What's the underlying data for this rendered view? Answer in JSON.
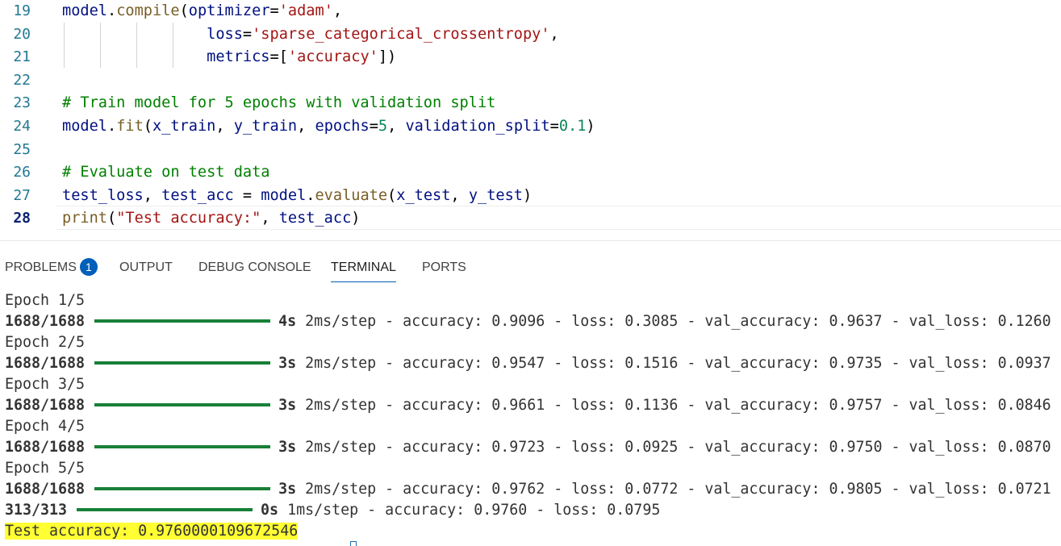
{
  "editor": {
    "lines": [
      {
        "no": "19",
        "tokens": [
          [
            "var",
            "model"
          ],
          [
            "def",
            "."
          ],
          [
            "fn",
            "compile"
          ],
          [
            "def",
            "("
          ],
          [
            "var",
            "optimizer"
          ],
          [
            "def",
            "="
          ],
          [
            "str",
            "'adam'"
          ],
          [
            "def",
            ","
          ]
        ]
      },
      {
        "no": "20",
        "tokens": [
          [
            "def",
            "                "
          ],
          [
            "var",
            "loss"
          ],
          [
            "def",
            "="
          ],
          [
            "str",
            "'sparse_categorical_crossentropy'"
          ],
          [
            "def",
            ","
          ]
        ]
      },
      {
        "no": "21",
        "tokens": [
          [
            "def",
            "                "
          ],
          [
            "var",
            "metrics"
          ],
          [
            "def",
            "=["
          ],
          [
            "str",
            "'accuracy'"
          ],
          [
            "def",
            "])"
          ]
        ]
      },
      {
        "no": "22",
        "tokens": []
      },
      {
        "no": "23",
        "tokens": [
          [
            "com",
            "# Train model for 5 epochs with validation split"
          ]
        ]
      },
      {
        "no": "24",
        "tokens": [
          [
            "var",
            "model"
          ],
          [
            "def",
            "."
          ],
          [
            "fn",
            "fit"
          ],
          [
            "def",
            "("
          ],
          [
            "var",
            "x_train"
          ],
          [
            "def",
            ", "
          ],
          [
            "var",
            "y_train"
          ],
          [
            "def",
            ", "
          ],
          [
            "var",
            "epochs"
          ],
          [
            "def",
            "="
          ],
          [
            "num",
            "5"
          ],
          [
            "def",
            ", "
          ],
          [
            "var",
            "validation_split"
          ],
          [
            "def",
            "="
          ],
          [
            "num",
            "0.1"
          ],
          [
            "def",
            ")"
          ]
        ]
      },
      {
        "no": "25",
        "tokens": []
      },
      {
        "no": "26",
        "tokens": [
          [
            "com",
            "# Evaluate on test data"
          ]
        ]
      },
      {
        "no": "27",
        "tokens": [
          [
            "var",
            "test_loss"
          ],
          [
            "def",
            ", "
          ],
          [
            "var",
            "test_acc"
          ],
          [
            "def",
            " = "
          ],
          [
            "var",
            "model"
          ],
          [
            "def",
            "."
          ],
          [
            "fn",
            "evaluate"
          ],
          [
            "def",
            "("
          ],
          [
            "var",
            "x_test"
          ],
          [
            "def",
            ", "
          ],
          [
            "var",
            "y_test"
          ],
          [
            "def",
            ")"
          ]
        ]
      },
      {
        "no": "28",
        "tokens": [
          [
            "fn",
            "print"
          ],
          [
            "def",
            "("
          ],
          [
            "str",
            "\"Test accuracy:\""
          ],
          [
            "def",
            ", "
          ],
          [
            "var",
            "test_acc"
          ],
          [
            "def",
            ")"
          ]
        ]
      }
    ]
  },
  "panel": {
    "tabs": [
      {
        "label": "PROBLEMS",
        "badge": "1"
      },
      {
        "label": "OUTPUT"
      },
      {
        "label": "DEBUG CONSOLE"
      },
      {
        "label": "TERMINAL",
        "active": true
      },
      {
        "label": "PORTS"
      }
    ]
  },
  "terminal": {
    "lines": [
      {
        "type": "text",
        "text": "Epoch 1/5"
      },
      {
        "type": "progress",
        "steps": "1688/1688",
        "progress": 1.0,
        "eta": "4s",
        "rest": " 2ms/step - accuracy: 0.9096 - loss: 0.3085 - val_accuracy: 0.9637 - val_loss: 0.1260"
      },
      {
        "type": "text",
        "text": "Epoch 2/5"
      },
      {
        "type": "progress",
        "steps": "1688/1688",
        "progress": 1.0,
        "eta": "3s",
        "rest": " 2ms/step - accuracy: 0.9547 - loss: 0.1516 - val_accuracy: 0.9735 - val_loss: 0.0937"
      },
      {
        "type": "text",
        "text": "Epoch 3/5"
      },
      {
        "type": "progress",
        "steps": "1688/1688",
        "progress": 1.0,
        "eta": "3s",
        "rest": " 2ms/step - accuracy: 0.9661 - loss: 0.1136 - val_accuracy: 0.9757 - val_loss: 0.0846"
      },
      {
        "type": "text",
        "text": "Epoch 4/5"
      },
      {
        "type": "progress",
        "steps": "1688/1688",
        "progress": 1.0,
        "eta": "3s",
        "rest": " 2ms/step - accuracy: 0.9723 - loss: 0.0925 - val_accuracy: 0.9750 - val_loss: 0.0870"
      },
      {
        "type": "text",
        "text": "Epoch 5/5"
      },
      {
        "type": "progress",
        "steps": "1688/1688",
        "progress": 1.0,
        "eta": "3s",
        "rest": " 2ms/step - accuracy: 0.9762 - loss: 0.0772 - val_accuracy: 0.9805 - val_loss: 0.0721"
      },
      {
        "type": "progress",
        "steps": "313/313",
        "progress": 1.0,
        "eta": "0s",
        "rest": " 1ms/step - accuracy: 0.9760 - loss: 0.0795"
      },
      {
        "type": "highlight",
        "text": "Test accuracy: 0.9760000109672546"
      }
    ]
  },
  "colors": {
    "progress_bar": "#188038",
    "highlight": "#ffff33",
    "accent": "#005fb8"
  }
}
